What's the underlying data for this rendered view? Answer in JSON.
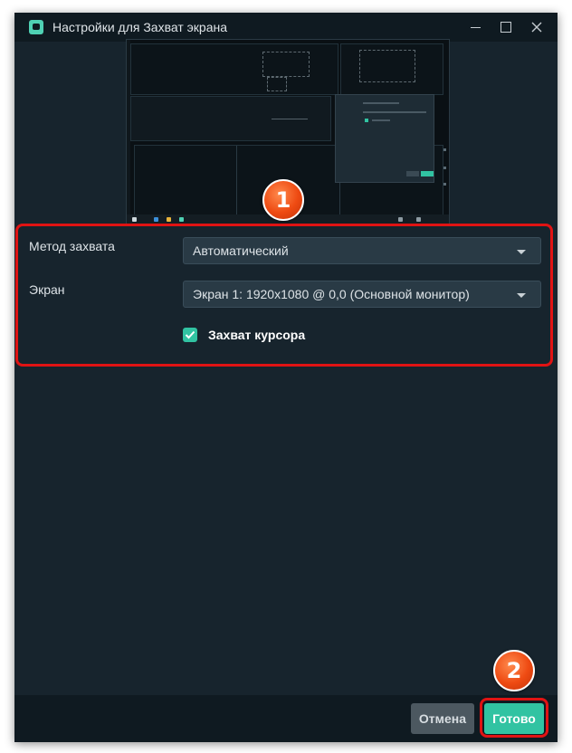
{
  "window": {
    "title": "Настройки для Захват экрана"
  },
  "form": {
    "capture_method_label": "Метод захвата",
    "capture_method_value": "Автоматический",
    "screen_label": "Экран",
    "screen_value": "Экран 1: 1920x1080 @ 0,0 (Основной монитор)",
    "cursor_capture_label": "Захват курсора",
    "cursor_capture_checked": true
  },
  "footer": {
    "cancel_label": "Отмена",
    "done_label": "Готово"
  },
  "annotations": {
    "badge_1": "1",
    "badge_2": "2"
  },
  "colors": {
    "accent": "#31c3a2",
    "highlight_red": "#e01313",
    "window_bg": "#17242d",
    "badge_orange": "#ee4a12"
  },
  "icons": [
    "app-logo-icon",
    "minimize-icon",
    "maximize-icon",
    "close-icon",
    "dropdown-caret-icon",
    "checkmark-icon"
  ]
}
